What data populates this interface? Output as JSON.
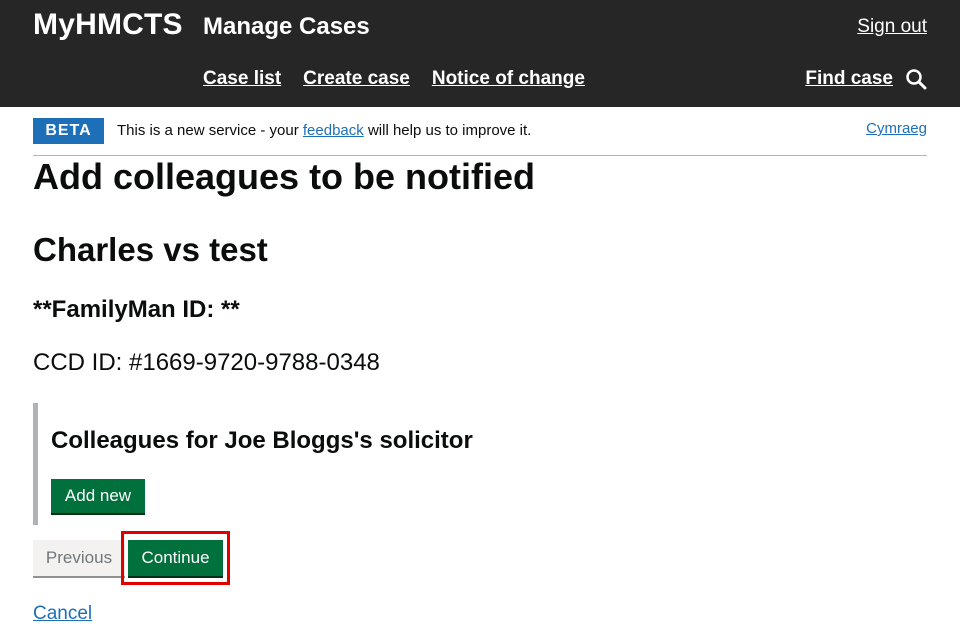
{
  "header": {
    "brand": "MyHMCTS",
    "service_name": "Manage Cases",
    "sign_out": "Sign out",
    "nav": [
      "Case list",
      "Create case",
      "Notice of change"
    ],
    "find_case": "Find case",
    "background_color": "#262626"
  },
  "phase_banner": {
    "tag": "BETA",
    "text_before": "This is a new service - your ",
    "feedback_link": "feedback",
    "text_after": " will help us to improve it.",
    "language_link": "Cymraeg",
    "tag_color": "#1d70b8"
  },
  "page": {
    "title": "Add colleagues to be notified",
    "case_name": "Charles vs test",
    "familyman_id": "**FamilyMan ID: **",
    "ccd_id": "CCD ID: #1669-9720-9788-0348"
  },
  "colleagues_section": {
    "title": "Colleagues for Joe Bloggs's solicitor",
    "add_new_label": "Add new"
  },
  "actions": {
    "previous_label": "Previous",
    "continue_label": "Continue",
    "cancel_label": "Cancel",
    "primary_color": "#00703c",
    "highlight_color": "#e00000"
  }
}
